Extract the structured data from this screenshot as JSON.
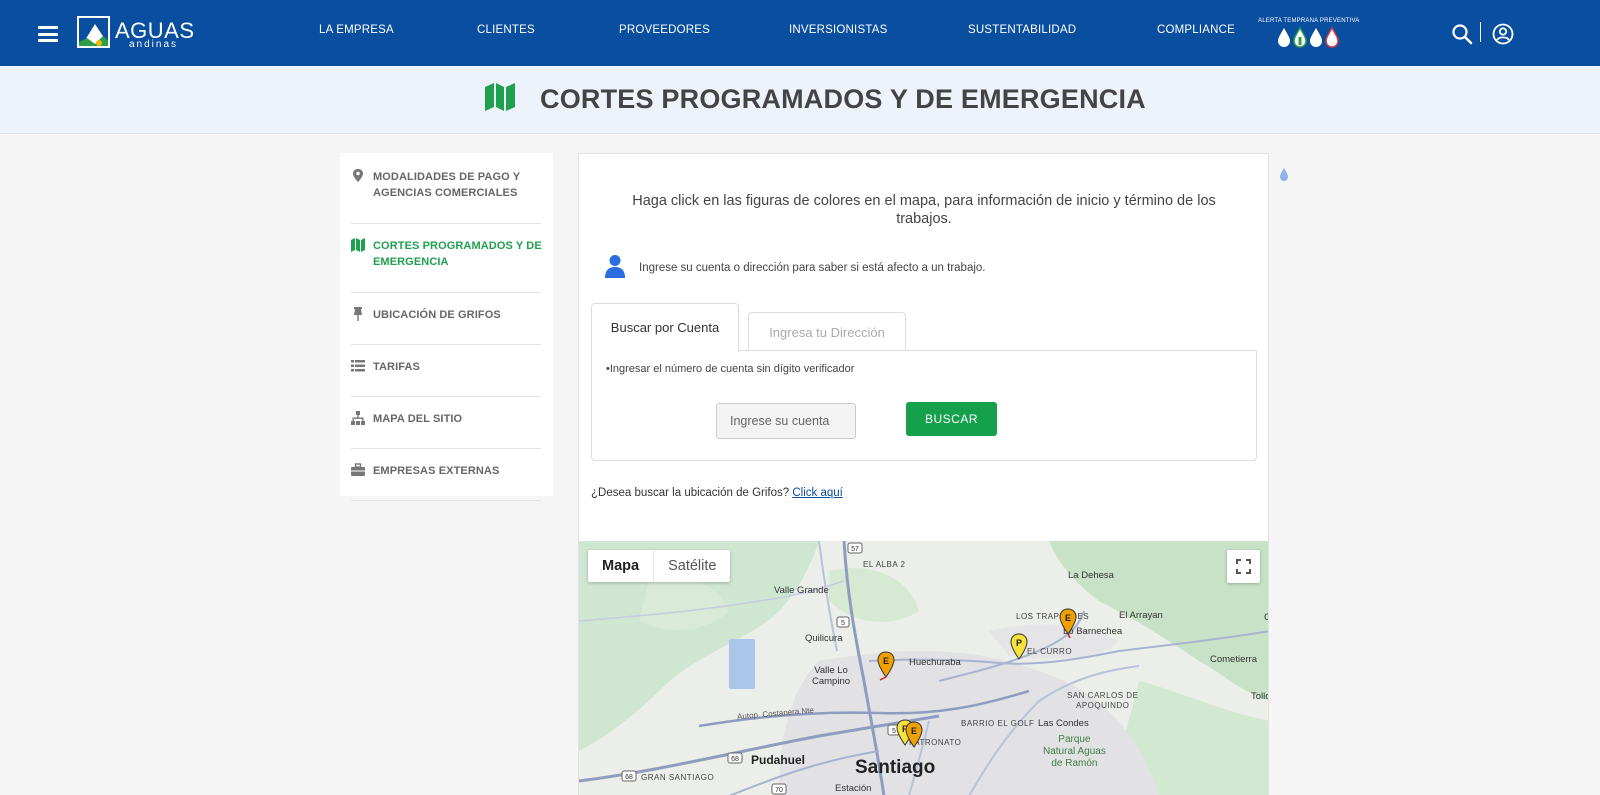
{
  "header": {
    "brand_name": "AGUAS",
    "brand_sub": "andinas",
    "nav": [
      "LA EMPRESA",
      "CLIENTES",
      "PROVEEDORES",
      "INVERSIONISTAS",
      "SUSTENTABILIDAD",
      "COMPLIANCE"
    ],
    "alert_label": "ALERTA TEMPRANA PREVENTIVA",
    "icons": [
      "menu-icon",
      "search-icon",
      "user-account-icon"
    ]
  },
  "page": {
    "title": "CORTES PROGRAMADOS Y DE EMERGENCIA",
    "title_icon": "map-icon"
  },
  "sidebar": {
    "items": [
      {
        "label": "MODALIDADES DE PAGO Y AGENCIAS COMERCIALES",
        "icon": "map-marker-icon",
        "active": false
      },
      {
        "label": "CORTES PROGRAMADOS Y DE EMERGENCIA",
        "icon": "map-icon",
        "active": true
      },
      {
        "label": "UBICACIÓN DE GRIFOS",
        "icon": "pin-icon",
        "active": false
      },
      {
        "label": "TARIFAS",
        "icon": "list-icon",
        "active": false
      },
      {
        "label": "MAPA DEL SITIO",
        "icon": "sitemap-icon",
        "active": false
      },
      {
        "label": "EMPRESAS EXTERNAS",
        "icon": "briefcase-icon",
        "active": false
      }
    ]
  },
  "main": {
    "intro": "Haga click en las figuras de colores en el mapa, para información de inicio y término de los trabajos.",
    "hint": "Ingrese su cuenta o dirección para saber si está afecto a un trabajo.",
    "tabs": [
      {
        "label": "Buscar por Cuenta",
        "active": true
      },
      {
        "label": "Ingresa tu Dirección",
        "active": false
      }
    ],
    "panel_note": "•Ingresar el número de cuenta sin dígito verificador",
    "account_placeholder": "Ingrese su cuenta",
    "search_button": "BUSCAR",
    "grifos_question": "¿Desea buscar la ubicación de Grifos?",
    "grifos_link": "Click aquí"
  },
  "map": {
    "type_selected": "Mapa",
    "type_other": "Satélite",
    "labels": {
      "el_alba": "EL ALBA 2",
      "la_dehesa": "La Dehesa",
      "valle_grande": "Valle Grande",
      "los_trapenses": "LOS TRAPENSES",
      "el_arrayan": "El Arrayan",
      "lo_barnechea": "Lo Barnechea",
      "quilicura": "Quilicura",
      "el_curro": "EL CURRO",
      "huechuraba": "Huechuraba",
      "cometierra": "Cometierra",
      "valle_lo_campino": "Valle Lo\nCampino",
      "san_carlos": "SAN CARLOS DE\nAPOQUINDO",
      "tollo": "Tollo",
      "autop": "Autop. Costanera Nte",
      "barrio_golf": "BARRIO EL GOLF",
      "las_condes": "Las Condes",
      "patronato": "PATRONATO",
      "parque": "Parque\nNatural Aguas\nde Ramón",
      "pudahuel": "Pudahuel",
      "santiago": "Santiago",
      "gran_santiago": "GRAN SANTIAGO",
      "estacion": "Estación",
      "co": "Co"
    },
    "route_shields": [
      "57",
      "5",
      "68",
      "68",
      "70",
      "5"
    ],
    "markers": [
      {
        "letter": "E",
        "color": "#f0a000",
        "kind": "emergencia"
      },
      {
        "letter": "E",
        "color": "#f0a000",
        "kind": "emergencia"
      },
      {
        "letter": "P",
        "color": "#f5e23a",
        "kind": "programado"
      },
      {
        "letter": "P",
        "color": "#f5e23a",
        "kind": "programado"
      },
      {
        "letter": "E",
        "color": "#f0a000",
        "kind": "emergencia"
      }
    ]
  },
  "colors": {
    "header_bg": "#0a4ea0",
    "accent_green": "#1fa04f",
    "button_green": "#14a04c"
  }
}
